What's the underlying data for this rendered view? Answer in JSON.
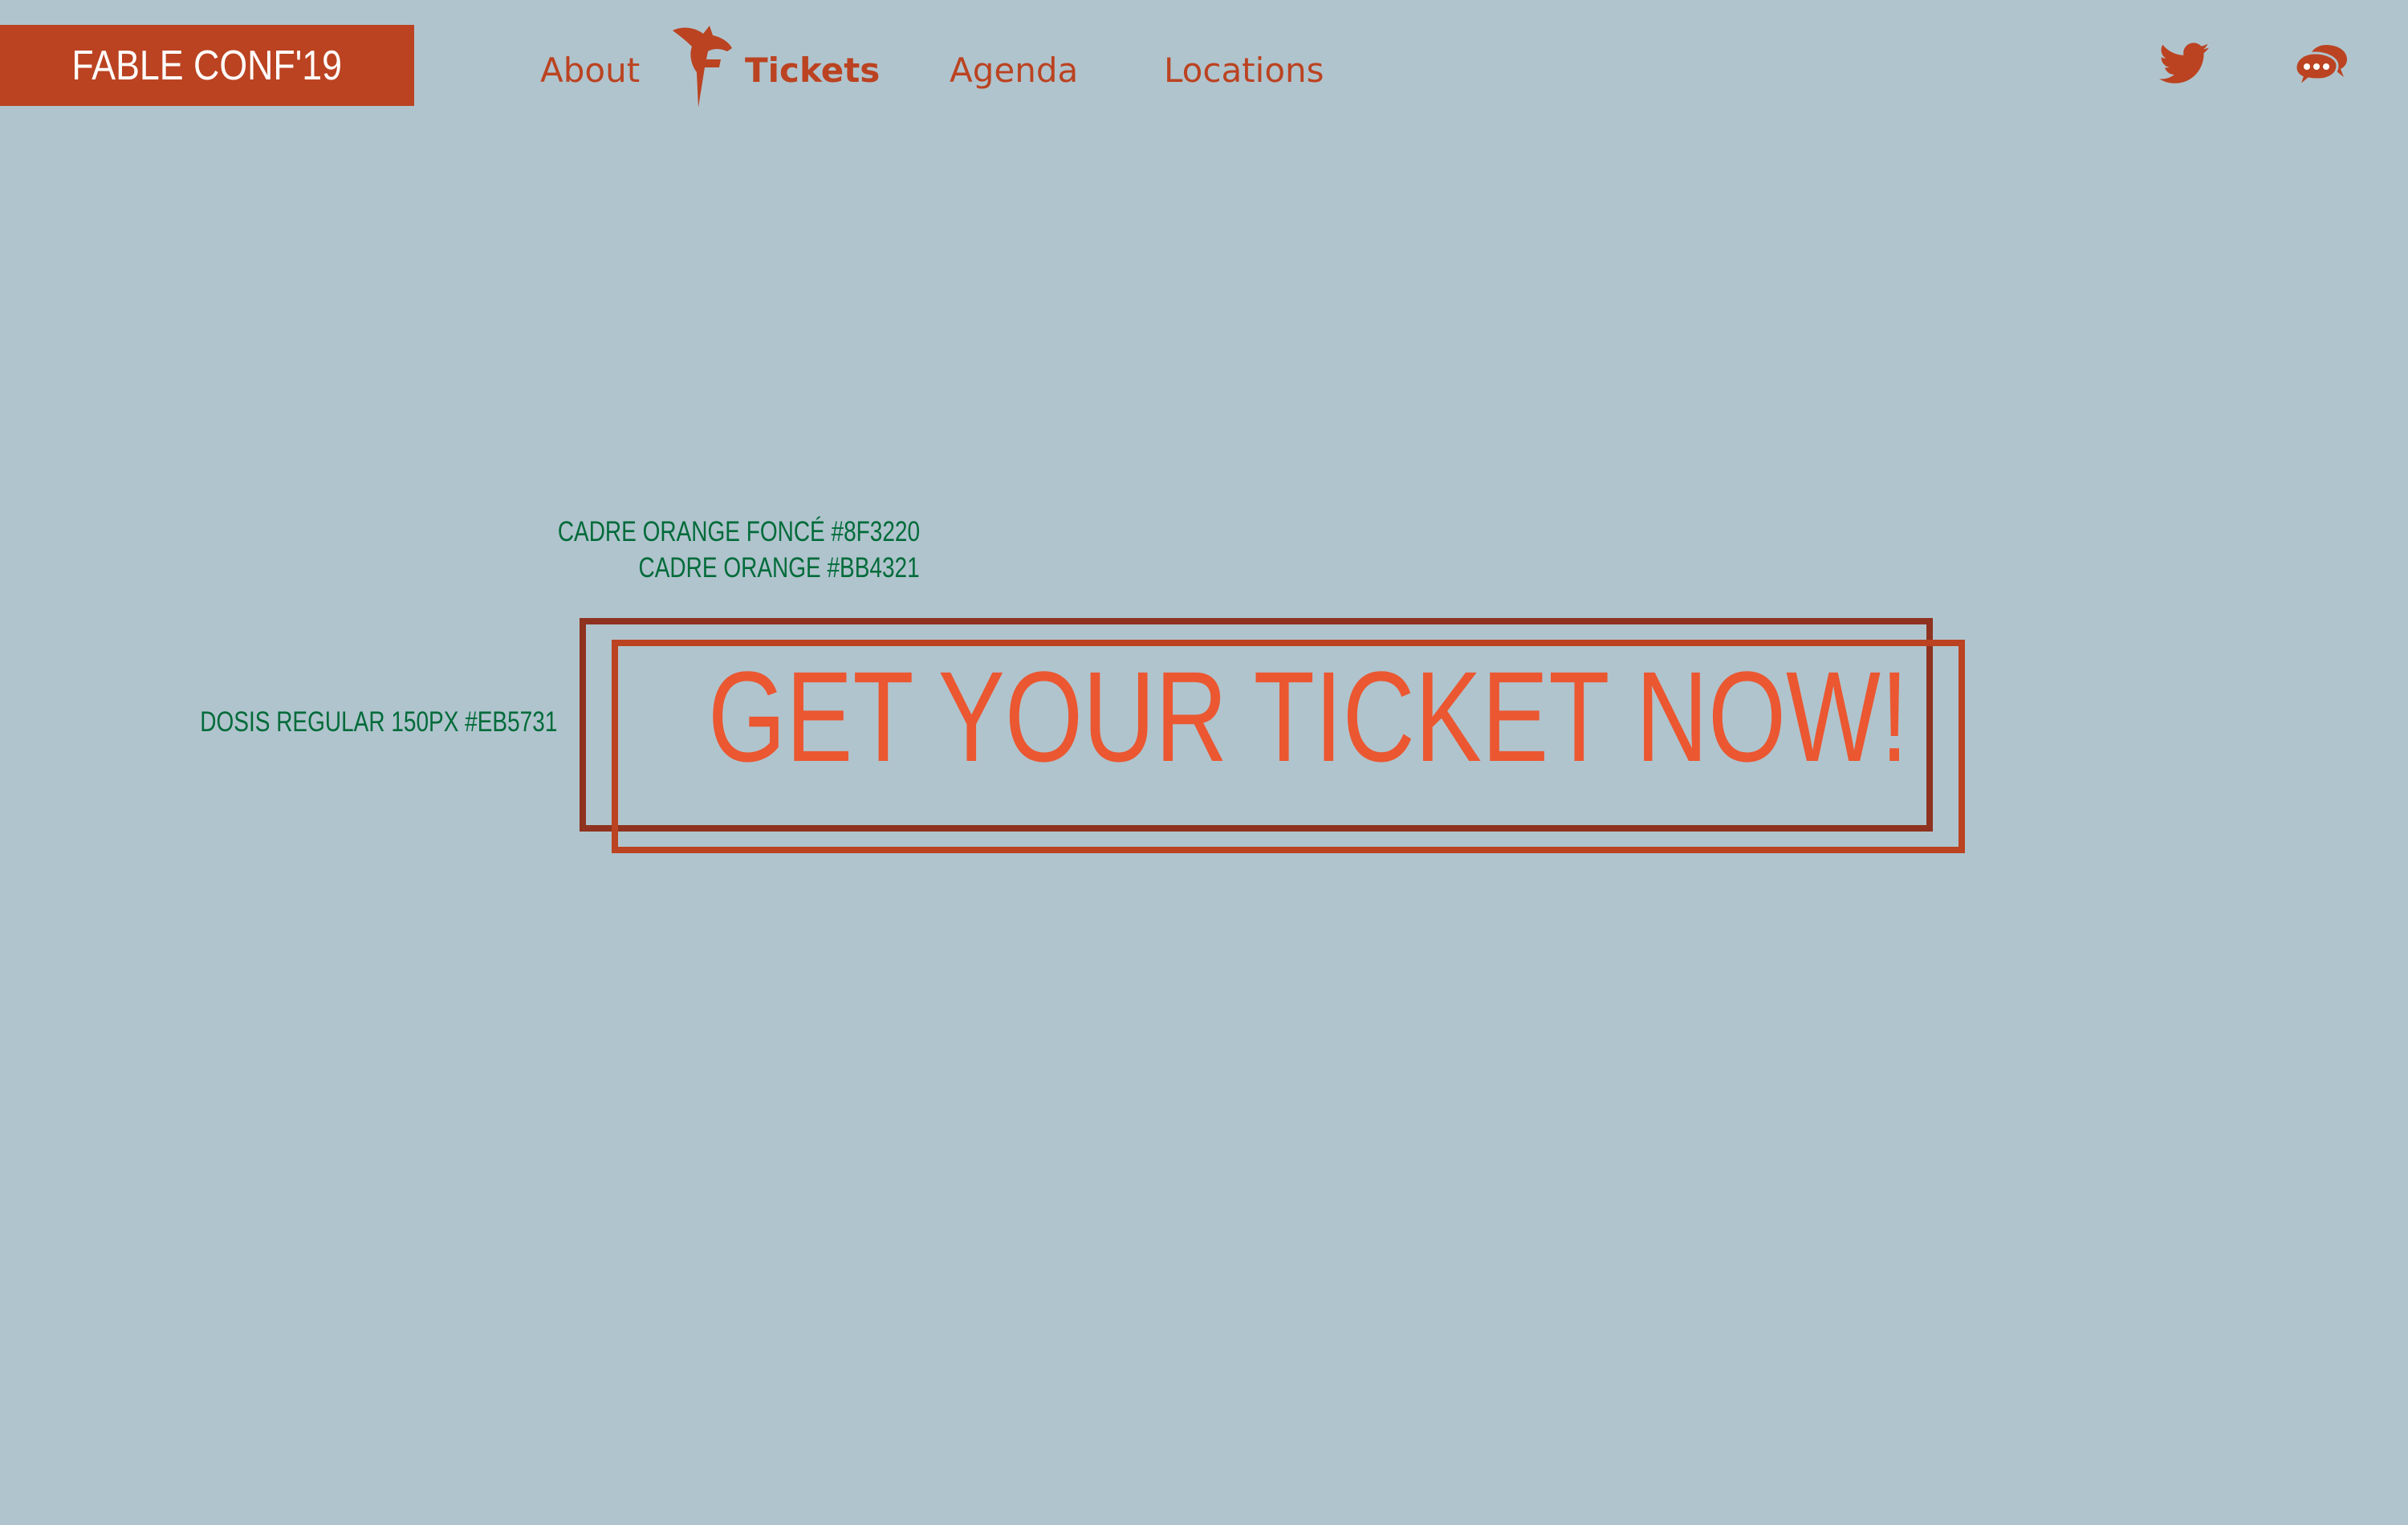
{
  "header": {
    "logo_text": "FABLE CONF'19",
    "nav": {
      "about": "About",
      "tickets": "Tickets",
      "agenda": "Agenda",
      "locations": "Locations"
    },
    "icons": {
      "brand_mark": "fox-head-icon",
      "twitter": "twitter-icon",
      "chat": "chat-bubble-icon"
    }
  },
  "annotations": {
    "dark_frame": "CADRE ORANGE FONCÉ #8F3220",
    "orange_frame": "CADRE ORANGE #BB4321",
    "font_spec": "DOSIS REGULAR 150PX #EB5731"
  },
  "cta": {
    "label": "GET YOUR TICKET NOW!"
  },
  "colors": {
    "background": "#b0c4cd",
    "brand": "#bb4321",
    "dark_frame": "#8f3220",
    "orange_frame": "#bb4321",
    "cta_text": "#eb5731",
    "annotation": "#006b3a"
  }
}
